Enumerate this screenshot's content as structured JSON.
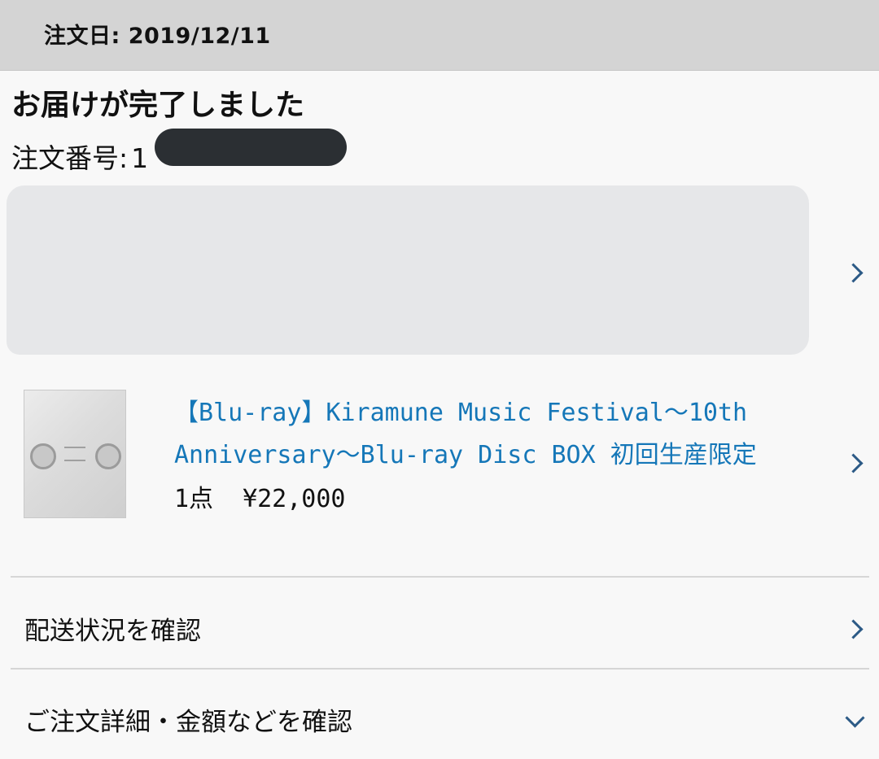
{
  "header": {
    "order_date": "注文日: 2019/12/11"
  },
  "order": {
    "status": "お届けが完了しました",
    "number_label": "注文番号:",
    "number_value": "1"
  },
  "product": {
    "title": "【Blu-ray】Kiramune Music Festival〜10th Anniversary〜Blu-ray Disc BOX 初回生産限定",
    "quantity": "1点",
    "price": "¥22,000"
  },
  "actions": {
    "track_shipment": "配送状況を確認",
    "order_details": "ご注文詳細・金額などを確認"
  },
  "colors": {
    "header_bg": "#d4d4d4",
    "link_blue": "#1577b8",
    "chevron_blue": "#2c5a86"
  },
  "icons": {
    "chevron_right": "chevron-right-icon",
    "chevron_down": "chevron-down-icon"
  }
}
